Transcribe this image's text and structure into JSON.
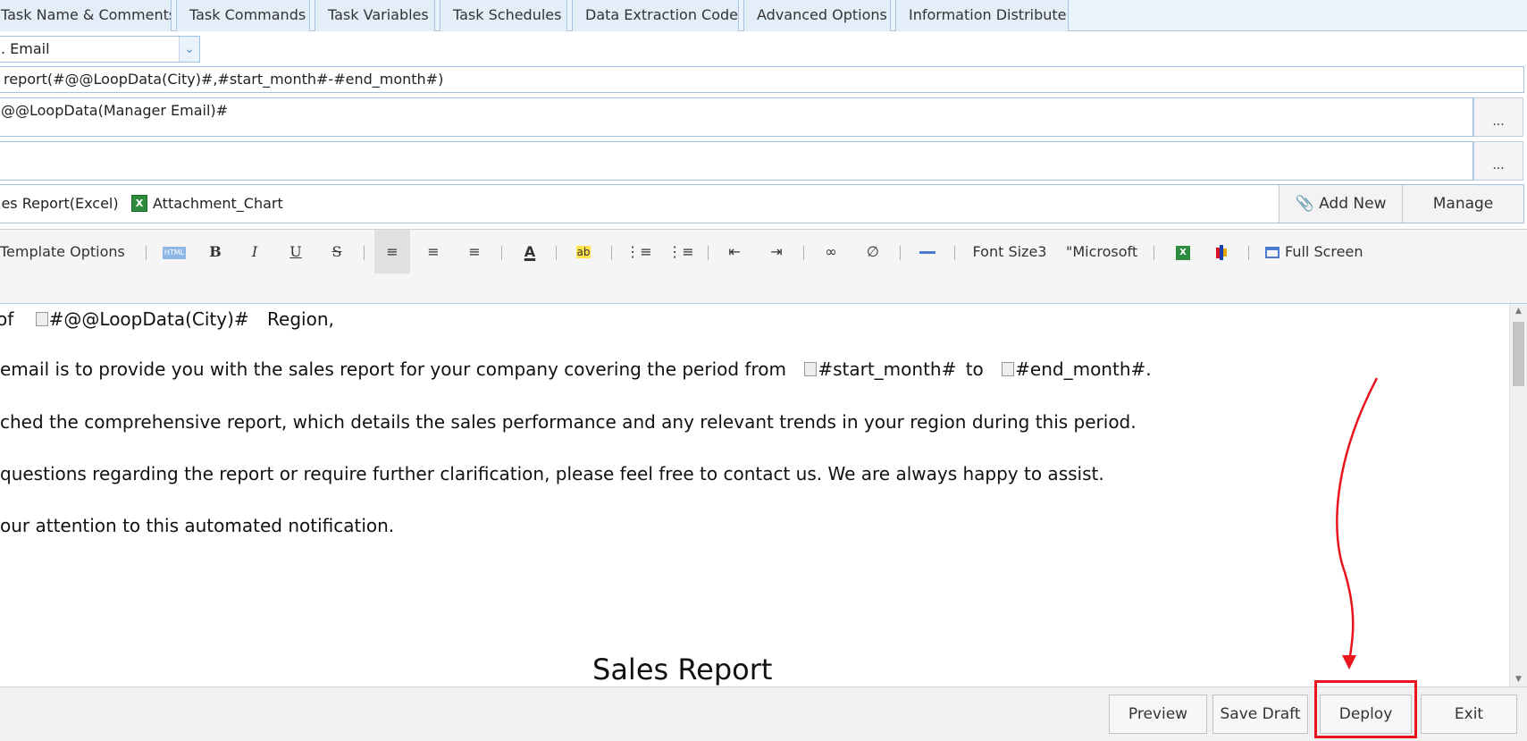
{
  "tabs": [
    {
      "label": "Task Name & Comments"
    },
    {
      "label": "Task Commands"
    },
    {
      "label": "Task Variables"
    },
    {
      "label": "Task Schedules"
    },
    {
      "label": "Data Extraction Code"
    },
    {
      "label": "Advanced Options"
    },
    {
      "label": "Information Distribute"
    }
  ],
  "form": {
    "send_type": ". Email",
    "subject": " report(#@@LoopData(City)#,#start_month#-#end_month#)",
    "to": "@@LoopData(Manager Email)#",
    "cc": "",
    "more_button": "...",
    "attachments": [
      {
        "label": "les Report(Excel)"
      },
      {
        "label": "Attachment_Chart"
      }
    ],
    "add_new_label": "Add New",
    "manage_label": "Manage"
  },
  "toolbar": {
    "template_options": "Template Options",
    "font_size": "Font Size3",
    "font_name": "\"Microsoft",
    "full_screen": "Full Screen",
    "html_badge": "HTML"
  },
  "body": {
    "line1_a": "of",
    "line1_city": "#@@LoopData(City)#",
    "line1_b": "Region,",
    "line2_a": " email is to provide you with the sales report for your company covering the period from",
    "line2_start": "#start_month#",
    "line2_to": "to",
    "line2_end": "#end_month#",
    "line2_dot": ".",
    "line3": "ched the comprehensive report, which details the sales performance and any relevant trends in your region during this period.",
    "line4": " questions regarding the report or require further clarification, please feel free to contact us. We are always happy to assist.",
    "line5": "our attention to this automated notification.",
    "report_title": "Sales Report"
  },
  "footer": {
    "preview": "Preview",
    "save_draft": "Save Draft",
    "deploy": "Deploy",
    "exit": "Exit"
  },
  "colors": {
    "highlight": "#e8141e",
    "tab_bg": "#e4eef9",
    "field_border": "#9fc1e2"
  }
}
